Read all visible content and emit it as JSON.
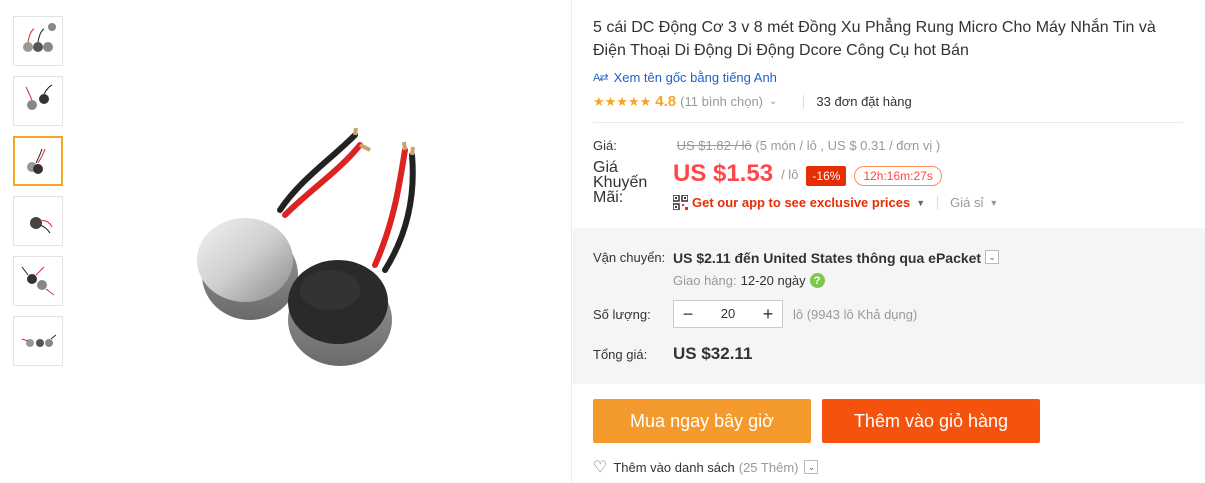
{
  "gallery": {
    "thumbnails": [
      "thumb-1",
      "thumb-2",
      "thumb-3",
      "thumb-4",
      "thumb-5",
      "thumb-6"
    ],
    "active_index": 2
  },
  "product": {
    "title": "5 cái DC Động Cơ 3 v 8 mét Đồng Xu Phẳng Rung Micro Cho Máy Nhắn Tin và Điện Thoại Di Động Di Động Dcore Công Cụ hot Bán",
    "translate_link": "Xem tên gốc bằng tiếng Anh",
    "translate_icon": "A⇄",
    "rating_value": "4.8",
    "rating_count": "(11 bình chọn)",
    "orders": "33 đơn đặt hàng",
    "stars": 5
  },
  "price": {
    "label": "Giá:",
    "old_price": "US $1.82 / lô",
    "old_extra": "(5 món / lô , US $ 0.31 / đơn vị )",
    "promo_label": "Giá Khuyến Mãi:",
    "promo_price": "US $1.53",
    "promo_unit": "/ lô",
    "discount": "-16%",
    "timer": "12h:16m:27s",
    "app_text": "Get our app to see exclusive prices",
    "wholesale": "Giá sỉ"
  },
  "shipping": {
    "label": "Vận chuyển:",
    "value": "US $2.11 đến United States thông qua ePacket",
    "delivery_label": "Giao hàng:",
    "delivery_days": "12-20 ngày",
    "help_icon": "?"
  },
  "quantity": {
    "label": "Số lượng:",
    "value": "20",
    "available": "lô (9943 lô Khả dụng)"
  },
  "total": {
    "label": "Tổng giá:",
    "value": "US $32.11"
  },
  "actions": {
    "buy_now": "Mua ngay bây giờ",
    "add_to_cart": "Thêm vào giỏ hàng",
    "wishlist": "Thêm vào danh sách",
    "wishlist_count": "(25 Thêm)"
  },
  "colors": {
    "accent_orange": "#f49a2d",
    "cart_red": "#f5520e",
    "price_red": "#ff4747",
    "star_gold": "#f5a623",
    "link_blue": "#2162c3"
  }
}
